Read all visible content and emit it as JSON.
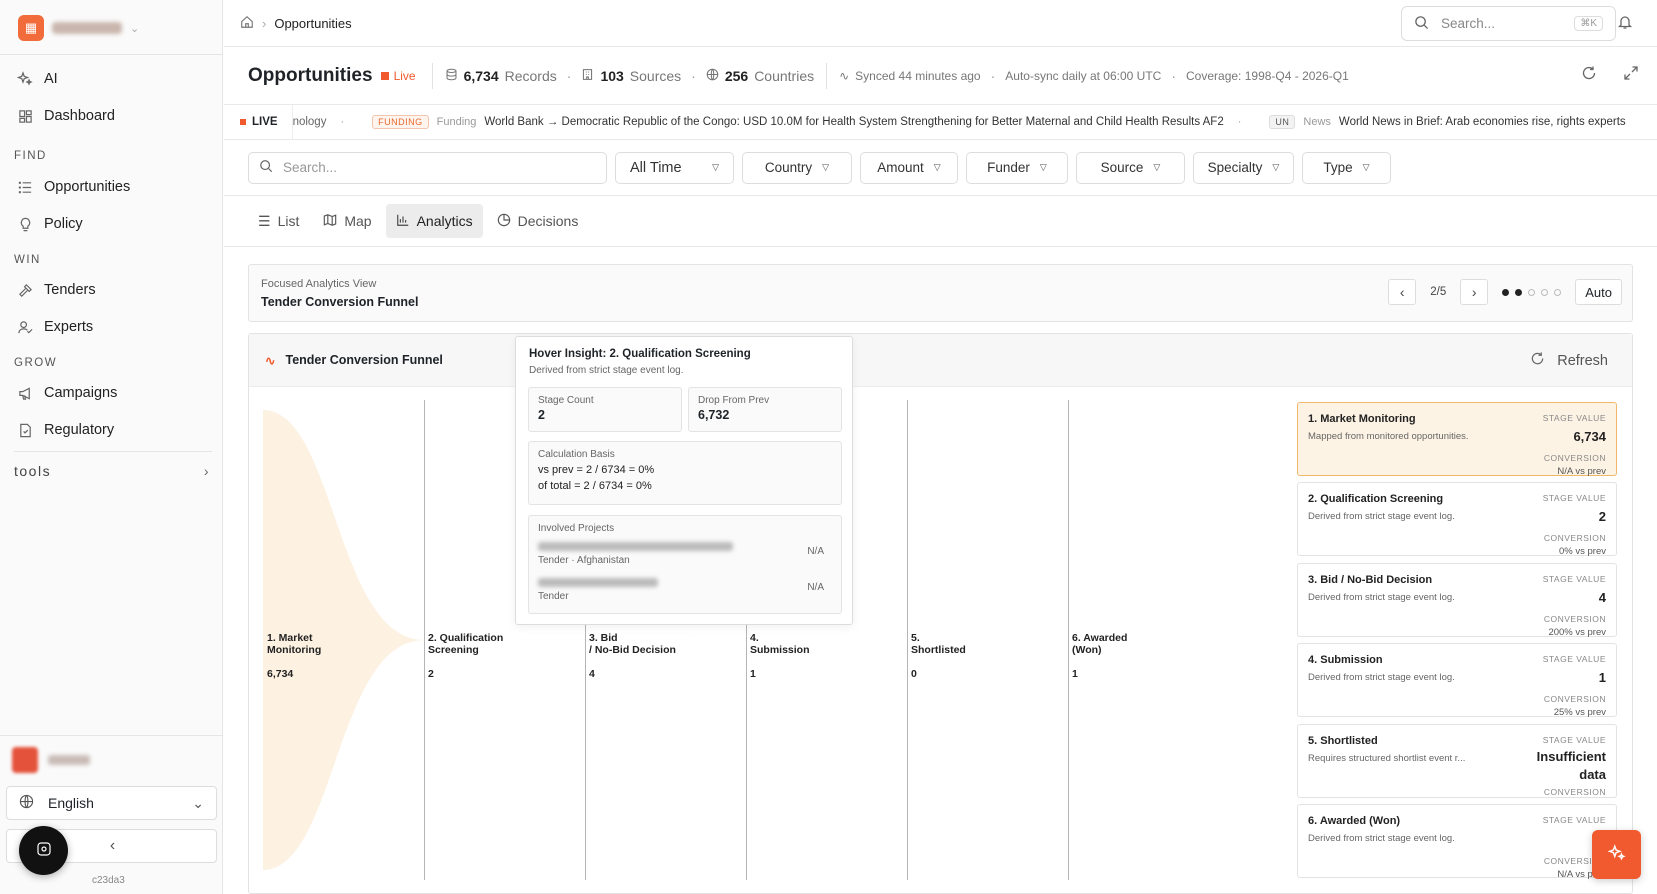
{
  "sidebar": {
    "workspace_name": "Conservé",
    "items": [
      {
        "label": "AI",
        "icon": "sparkle-icon"
      },
      {
        "label": "Dashboard",
        "icon": "grid-icon"
      },
      {
        "label": "Opportunities",
        "icon": "list-icon"
      },
      {
        "label": "Policy",
        "icon": "lightbulb-icon"
      },
      {
        "label": "Tenders",
        "icon": "gavel-icon"
      },
      {
        "label": "Experts",
        "icon": "user-check-icon"
      },
      {
        "label": "Campaigns",
        "icon": "megaphone-icon"
      },
      {
        "label": "Regulatory",
        "icon": "file-check-icon"
      }
    ],
    "sections": {
      "find": "FIND",
      "win": "WIN",
      "grow": "GROW"
    },
    "tools": "tools",
    "language": "English",
    "build": "c23da3"
  },
  "topbar": {
    "breadcrumb": "Opportunities",
    "search_placeholder": "Search...",
    "shortcut": "⌘K"
  },
  "header": {
    "title": "Opportunities",
    "live": "Live",
    "records_value": "6,734",
    "records_label": "Records",
    "sources_value": "103",
    "sources_label": "Sources",
    "countries_value": "256",
    "countries_label": "Countries",
    "synced": "Synced 44 minutes ago",
    "autosync": "Auto-sync daily at 06:00 UTC",
    "coverage": "Coverage: 1998-Q4 - 2026-Q1"
  },
  "ticker": {
    "live": "LIVE",
    "items": [
      {
        "tag": "",
        "source": "",
        "text": "nology"
      },
      {
        "tag": "FUNDING",
        "source": "Funding",
        "text": "World Bank → Democratic Republic of the Congo: USD 10.0M for Health System Strengthening for Better Maternal and Child Health Results AF2"
      },
      {
        "tag": "UN",
        "source": "News",
        "text": "World News in Brief: Arab economies rise, rights experts"
      }
    ]
  },
  "filters": {
    "search_placeholder": "Search...",
    "dropdowns": [
      "All Time",
      "Country",
      "Amount",
      "Funder",
      "Source",
      "Specialty",
      "Type"
    ]
  },
  "view_tabs": [
    "List",
    "Map",
    "Analytics",
    "Decisions"
  ],
  "focus": {
    "subtitle": "Focused Analytics View",
    "title": "Tender Conversion Funnel",
    "page": "2/5",
    "auto": "Auto"
  },
  "panel": {
    "title": "Tender Conversion Funnel",
    "refresh": "Refresh"
  },
  "chart_data": {
    "type": "funnel",
    "title": "Tender Conversion Funnel",
    "categories": [
      "1. Market Monitoring",
      "2. Qualification Screening",
      "3. Bid / No-Bid Decision",
      "4. Submission",
      "5. Shortlisted",
      "6. Awarded (Won)"
    ],
    "values": [
      6734,
      2,
      4,
      1,
      0,
      1
    ],
    "labels": [
      "6,734",
      "2",
      "4",
      "1",
      "0",
      "1"
    ],
    "axis_labels": [
      [
        "1. Market",
        "Monitoring"
      ],
      [
        "2. Qualification",
        "Screening"
      ],
      [
        "3. Bid",
        "/ No-Bid Decision"
      ],
      [
        "4.",
        "Submission"
      ],
      [
        "5.",
        "Shortlisted"
      ],
      [
        "6. Awarded",
        "(Won)"
      ]
    ],
    "fill_color": "#fdf1e2"
  },
  "tooltip": {
    "title": "Hover Insight: 2. Qualification Screening",
    "sub": "Derived from strict stage event log.",
    "stage_count_label": "Stage Count",
    "stage_count": "2",
    "drop_label": "Drop From Prev",
    "drop": "6,732",
    "calc_label": "Calculation Basis",
    "calc_prev": "vs prev = 2 / 6734 = 0%",
    "calc_total": "of total = 2 / 6734 = 0%",
    "projects_label": "Involved Projects",
    "projects": [
      {
        "type": "Tender · Afghanistan",
        "value": "N/A"
      },
      {
        "type": "Tender",
        "value": "N/A"
      }
    ]
  },
  "stage_cards": [
    {
      "title": "1. Market Monitoring",
      "desc": "Mapped from monitored opportunities.",
      "value_label": "STAGE VALUE",
      "value": "6,734",
      "conv_label": "CONVERSION",
      "conv": "N/A vs prev",
      "active": true
    },
    {
      "title": "2. Qualification Screening",
      "desc": "Derived from strict stage event log.",
      "value_label": "STAGE VALUE",
      "value": "2",
      "conv_label": "CONVERSION",
      "conv": "0% vs prev"
    },
    {
      "title": "3. Bid / No-Bid Decision",
      "desc": "Derived from strict stage event log.",
      "value_label": "STAGE VALUE",
      "value": "4",
      "conv_label": "CONVERSION",
      "conv": "200% vs prev"
    },
    {
      "title": "4. Submission",
      "desc": "Derived from strict stage event log.",
      "value_label": "STAGE VALUE",
      "value": "1",
      "conv_label": "CONVERSION",
      "conv": "25% vs prev"
    },
    {
      "title": "5. Shortlisted",
      "desc": "Requires structured shortlist event r...",
      "value_label": "STAGE VALUE",
      "value": "Insufficient data",
      "conv_label": "CONVERSION",
      "conv": ""
    },
    {
      "title": "6. Awarded (Won)",
      "desc": "Derived from strict stage event log.",
      "value_label": "STAGE VALUE",
      "value": "",
      "conv_label": "CONVERSION",
      "conv": "N/A vs prev"
    }
  ],
  "colors": {
    "accent": "#f05a2c",
    "funnel": "#fdf1e2",
    "active_card": "#fdf3e4"
  }
}
